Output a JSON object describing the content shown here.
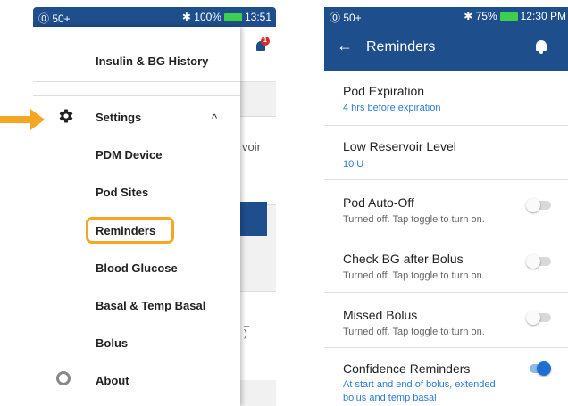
{
  "left_phone": {
    "status_bar": {
      "left": "⓪ 50+",
      "right": "✱ 100%",
      "time": "13:51"
    },
    "drawer": {
      "items": [
        {
          "label": "Insulin & BG History"
        },
        {
          "label": "Settings"
        },
        {
          "label": "PDM Device"
        },
        {
          "label": "Pod Sites"
        },
        {
          "label": "Reminders"
        },
        {
          "label": "Blood Glucose"
        },
        {
          "label": "Basal & Temp Basal"
        },
        {
          "label": "Bolus"
        },
        {
          "label": "About"
        }
      ],
      "settings_caret": "^"
    },
    "background": {
      "notification_count": "1",
      "card_fragment": "voir",
      "row_fragment": "_\n)"
    },
    "highlight_color": "#f5a623"
  },
  "right_phone": {
    "status_bar": {
      "left": "⓪ 50+",
      "right": "✱ 75%",
      "time": "12:30 PM"
    },
    "app_bar": {
      "title": "Reminders",
      "back_icon": "←"
    },
    "settings": [
      {
        "title": "Pod Expiration",
        "subtitle": "4 hrs before expiration"
      },
      {
        "title": "Low Reservoir Level",
        "subtitle": "10 U"
      },
      {
        "title": "Pod Auto-Off",
        "subtitle": "Turned off. Tap toggle to turn on.",
        "toggle": false
      },
      {
        "title": "Check BG after Bolus",
        "subtitle": "Turned off. Tap toggle to turn on.",
        "toggle": false
      },
      {
        "title": "Missed Bolus",
        "subtitle": "Turned off. Tap toggle to turn on.",
        "toggle": false
      },
      {
        "title": "Confidence Reminders",
        "subtitle_line1": "At start and end of bolus, extended",
        "subtitle_line2": "bolus and temp basal",
        "toggle": true
      }
    ]
  },
  "colors": {
    "header": "#1f4e8c",
    "accent_blue": "#2b7bd6",
    "arrow_orange": "#f5a623",
    "toggle_on": "#1f6ed4"
  }
}
